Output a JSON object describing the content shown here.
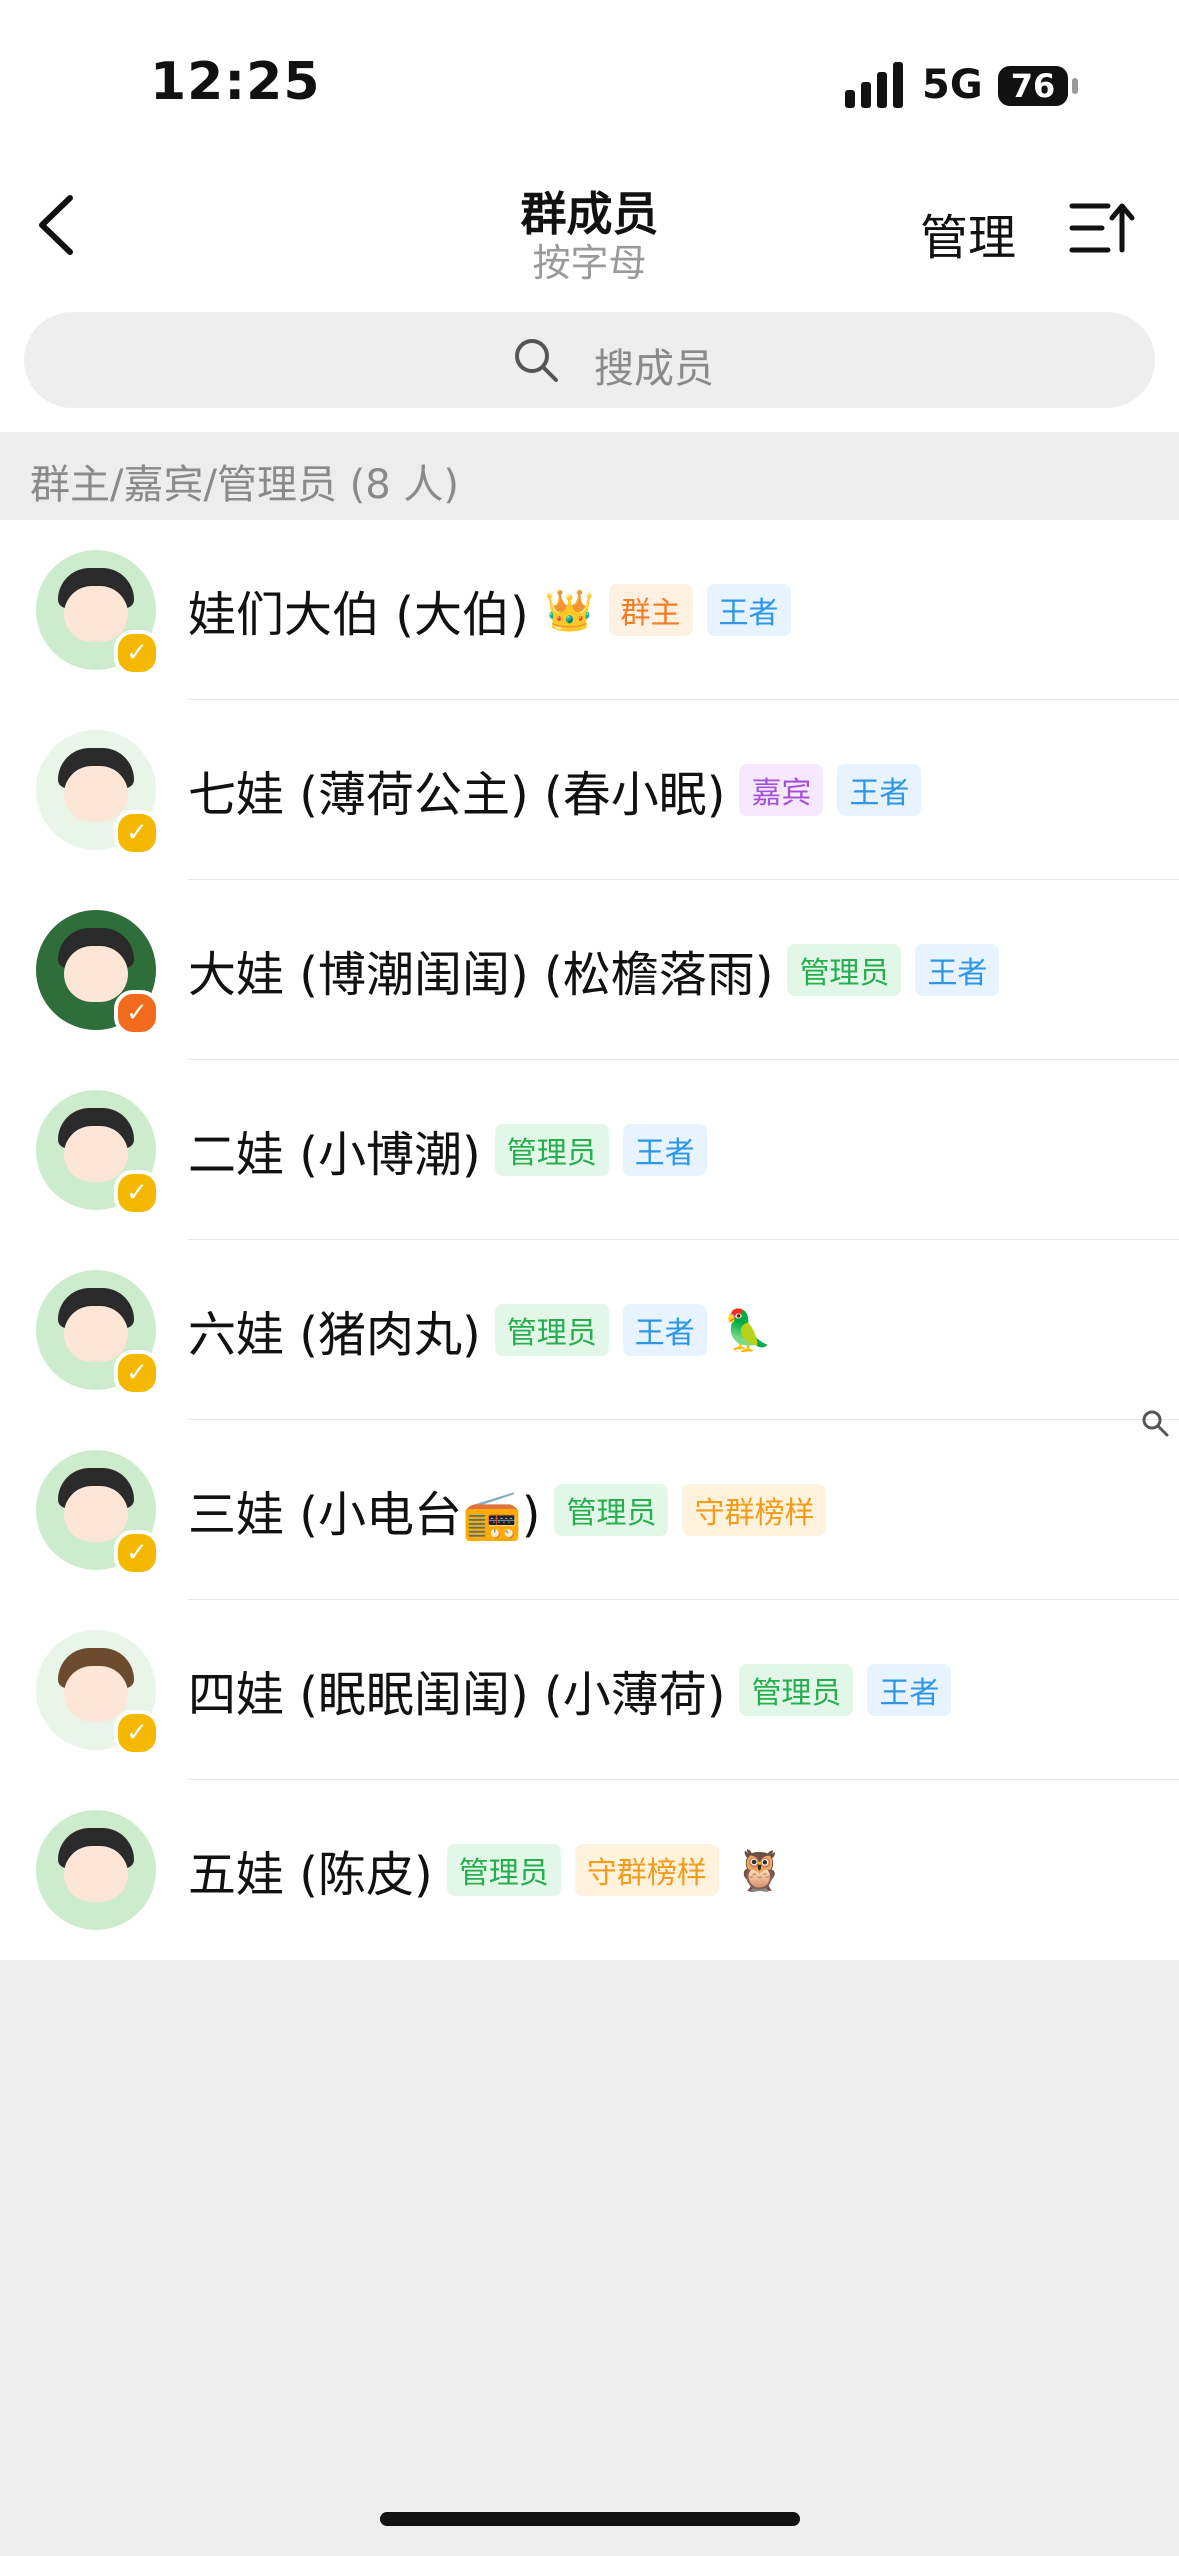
{
  "status_bar": {
    "time": "12:25",
    "network": "5G",
    "battery": "76"
  },
  "nav": {
    "title": "群成员",
    "subtitle": "按字母",
    "manage_label": "管理",
    "back_icon": "chevron-left-icon",
    "sort_icon": "sort-icon"
  },
  "search": {
    "placeholder": "搜成员",
    "icon": "search-icon"
  },
  "section": {
    "header": "群主/嘉宾/管理员 (8 人)"
  },
  "members": [
    {
      "name": "娃们大伯 (大伯)",
      "emoji": "👑",
      "tags": [
        {
          "label": "群主",
          "kind": "owner"
        },
        {
          "label": "王者",
          "kind": "king"
        }
      ]
    },
    {
      "name": "七娃 (薄荷公主) (春小眠)",
      "tags": [
        {
          "label": "嘉宾",
          "kind": "guest"
        },
        {
          "label": "王者",
          "kind": "king"
        }
      ]
    },
    {
      "name": "大娃 (博潮闺闺) (松檐落雨)",
      "tags": [
        {
          "label": "管理员",
          "kind": "admin"
        },
        {
          "label": "王者",
          "kind": "king"
        }
      ]
    },
    {
      "name": "二娃 (小博潮)",
      "tags": [
        {
          "label": "管理员",
          "kind": "admin"
        },
        {
          "label": "王者",
          "kind": "king"
        }
      ]
    },
    {
      "name": "六娃 (猪肉丸)",
      "tags": [
        {
          "label": "管理员",
          "kind": "admin"
        },
        {
          "label": "王者",
          "kind": "king"
        }
      ],
      "trailing_emoji": "🦜"
    },
    {
      "name": "三娃 (小电台📻)",
      "tags": [
        {
          "label": "管理员",
          "kind": "admin"
        },
        {
          "label": "守群榜样",
          "kind": "guard"
        }
      ]
    },
    {
      "name": "四娃 (眠眠闺闺) (小薄荷)",
      "tags": [
        {
          "label": "管理员",
          "kind": "admin"
        },
        {
          "label": "王者",
          "kind": "king"
        }
      ]
    },
    {
      "name": "五娃 (陈皮)",
      "tags": [
        {
          "label": "管理员",
          "kind": "admin"
        },
        {
          "label": "守群榜样",
          "kind": "guard"
        }
      ],
      "trailing_emoji": "🦉"
    }
  ]
}
